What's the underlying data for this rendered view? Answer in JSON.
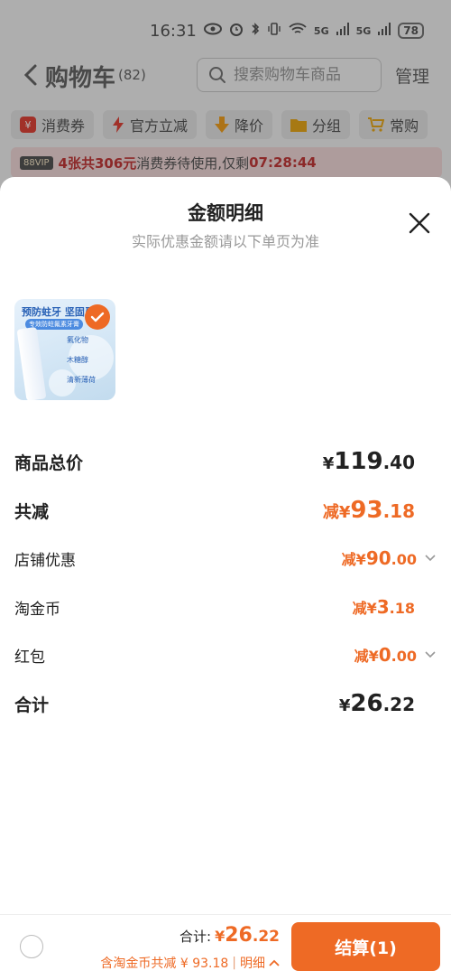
{
  "status_bar": {
    "time": "16:31",
    "battery": "78",
    "signal_label": "5G"
  },
  "header": {
    "title": "购物车",
    "count": "(82)",
    "search_placeholder": "搜索购物车商品",
    "manage": "管理"
  },
  "chips": [
    {
      "label": "消费券",
      "icon": "coupon-icon",
      "color": "#e0443a"
    },
    {
      "label": "官方立减",
      "icon": "lightning-icon",
      "color": "#e0443a"
    },
    {
      "label": "降价",
      "icon": "down-arrow-icon",
      "color": "#f0a020"
    },
    {
      "label": "分组",
      "icon": "folder-icon",
      "color": "#e8a81c"
    },
    {
      "label": "常购",
      "icon": "cart-icon",
      "color": "#e8a81c"
    }
  ],
  "banner": {
    "vip": "88VIP",
    "highlight": "4张共306元",
    "text": "消费券待使用,仅剩",
    "countdown": "07:28:44"
  },
  "sheet": {
    "title": "金额明细",
    "subtitle": "实际优惠金额请以下单页为准",
    "product": {
      "headline": "预防蛀牙 坚固牙",
      "tag": "专效防蛀氟素牙膏",
      "features": [
        "氟化物",
        "木糖醇",
        "清新薄荷"
      ]
    },
    "rows": [
      {
        "label": "商品总价",
        "prefix": "¥",
        "int": "119",
        "dec": ".40"
      },
      {
        "label": "共减",
        "prefix": "减¥",
        "int": "93",
        "dec": ".18"
      },
      {
        "label": "店铺优惠",
        "prefix": "减¥",
        "int": "90",
        "dec": ".00"
      },
      {
        "label": "淘金币",
        "prefix": "减¥",
        "int": "3",
        "dec": ".18"
      },
      {
        "label": "红包",
        "prefix": "减¥",
        "int": "0",
        "dec": ".00"
      },
      {
        "label": "合计",
        "prefix": "¥",
        "int": "26",
        "dec": ".22"
      }
    ]
  },
  "bottom": {
    "total_label": "合计:",
    "total_prefix": "¥",
    "total_int": "26",
    "total_dec": ".22",
    "discount_text": "含淘金币共减 ¥ 93.18",
    "separator": "|",
    "detail": "明细",
    "checkout": "结算(1)"
  },
  "colors": {
    "accent": "#ee6a25",
    "banner_red": "#c23a3a"
  }
}
